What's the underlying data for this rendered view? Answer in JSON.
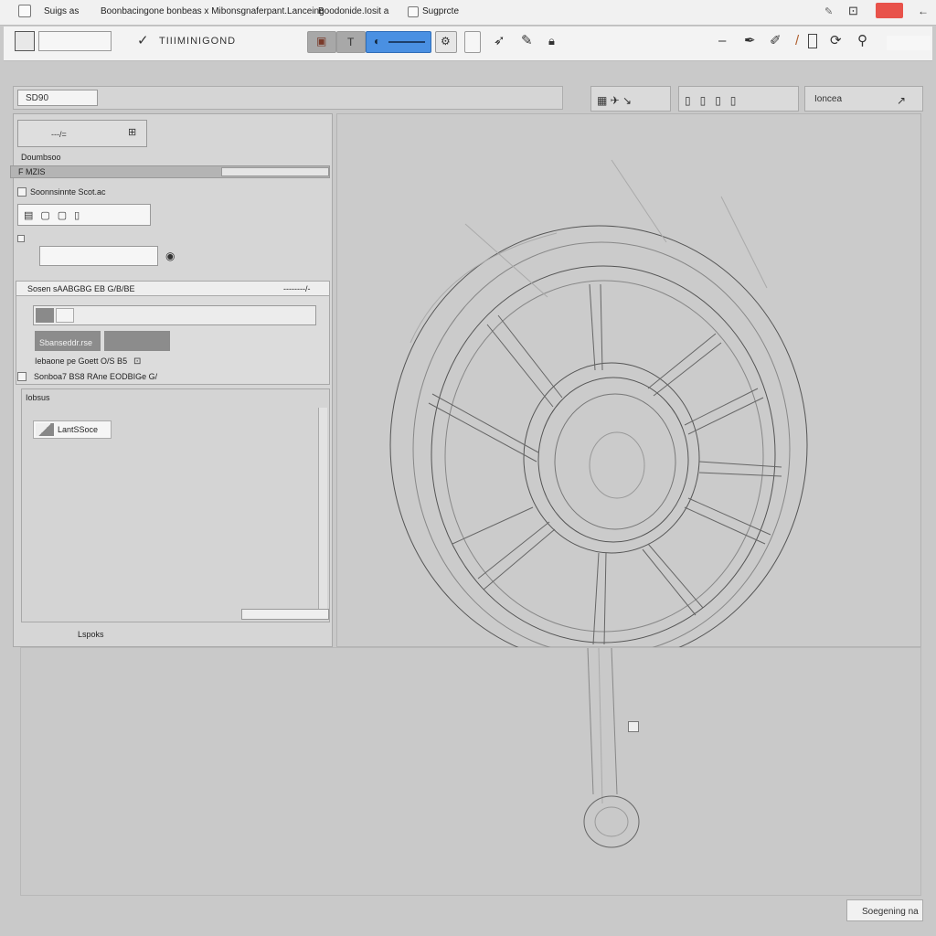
{
  "titlebar": {
    "app_name": "Suigs as",
    "doc_title": "Boonbacingone bonbeas x Mibonsgnaferpant.Lanceing",
    "doc_suffix": "Boodonide.Iosit a",
    "tab_label": "Sugprcte"
  },
  "toolbar": {
    "tool_text": "TIIIMINIGOND",
    "active_tool": "pen-tool"
  },
  "bar2": {
    "field_value": "SD90"
  },
  "right_groups": {
    "group3_label": "Ioncea"
  },
  "left_panel": {
    "top_box_text": "---/=",
    "subtitle": "Doumbsoo",
    "section_tab": "F MZIS",
    "section_title": "Soonnsinnte Scot.ac",
    "group_header": "Sosen sAABGBG EB G/B/BE",
    "group_header_right": "--------/-",
    "btn_primary": "Sbanseddr.rse",
    "btn_secondary": "",
    "desc_text": "Iebaone pe Goett O/S B5",
    "checkbox_label": "Sonboa7 BS8 RAne EODBIGe G/",
    "list_title": "Iobsus",
    "list_item": "LantSSoce",
    "footer_label": "Lspoks"
  },
  "status": {
    "button_label": "Soegening na"
  },
  "colors": {
    "accent": "#4a90e2",
    "close": "#e8524a",
    "background": "#c9c9c9"
  },
  "icons": [
    "file-icon",
    "pen-tool-icon",
    "brush-icon",
    "circle-icon",
    "settings-icon",
    "zoom-icon",
    "lock-icon"
  ]
}
